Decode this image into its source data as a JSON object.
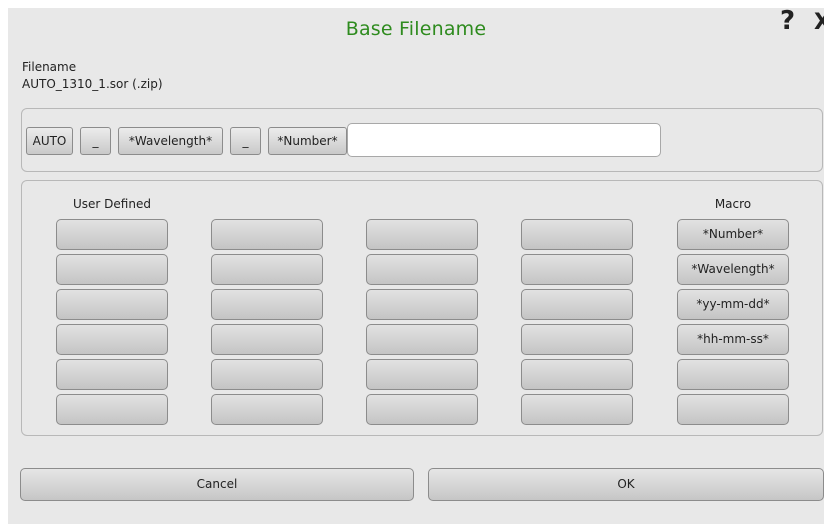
{
  "dialog": {
    "title": "Base Filename",
    "help_icon": "?",
    "close_icon": "X"
  },
  "filename": {
    "label": "Filename",
    "value": "AUTO_1310_1.sor (.zip)"
  },
  "components": [
    {
      "label": "AUTO"
    },
    {
      "label": "_"
    },
    {
      "label": "*Wavelength*"
    },
    {
      "label": "_"
    },
    {
      "label": "*Number*"
    }
  ],
  "name_input": {
    "value": ""
  },
  "user_defined": {
    "header": "User Defined",
    "slots": [
      "",
      "",
      "",
      "",
      "",
      "",
      "",
      "",
      "",
      "",
      "",
      "",
      "",
      "",
      "",
      "",
      "",
      "",
      "",
      "",
      "",
      "",
      "",
      ""
    ]
  },
  "macro": {
    "header": "Macro",
    "items": [
      "*Number*",
      "*Wavelength*",
      "*yy-mm-dd*",
      "*hh-mm-ss*",
      "",
      ""
    ]
  },
  "buttons": {
    "cancel": "Cancel",
    "ok": "OK"
  },
  "colors": {
    "title": "#2e8b1e",
    "background": "#e8e8e8"
  }
}
